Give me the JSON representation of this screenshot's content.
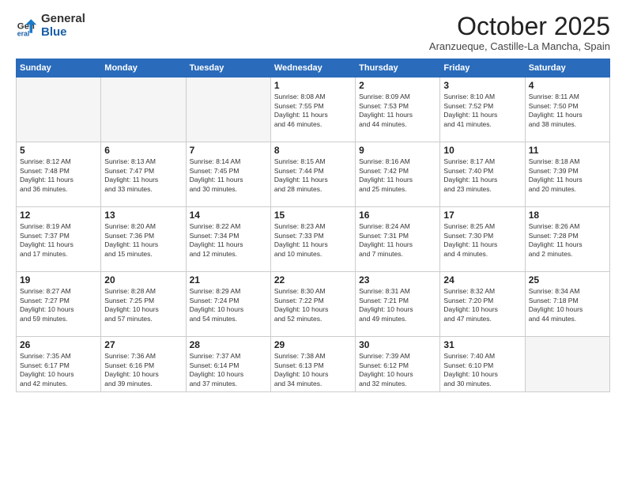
{
  "header": {
    "logo_general": "General",
    "logo_blue": "Blue",
    "month_year": "October 2025",
    "location": "Aranzueque, Castille-La Mancha, Spain"
  },
  "weekdays": [
    "Sunday",
    "Monday",
    "Tuesday",
    "Wednesday",
    "Thursday",
    "Friday",
    "Saturday"
  ],
  "weeks": [
    [
      {
        "num": "",
        "info": ""
      },
      {
        "num": "",
        "info": ""
      },
      {
        "num": "",
        "info": ""
      },
      {
        "num": "1",
        "info": "Sunrise: 8:08 AM\nSunset: 7:55 PM\nDaylight: 11 hours\nand 46 minutes."
      },
      {
        "num": "2",
        "info": "Sunrise: 8:09 AM\nSunset: 7:53 PM\nDaylight: 11 hours\nand 44 minutes."
      },
      {
        "num": "3",
        "info": "Sunrise: 8:10 AM\nSunset: 7:52 PM\nDaylight: 11 hours\nand 41 minutes."
      },
      {
        "num": "4",
        "info": "Sunrise: 8:11 AM\nSunset: 7:50 PM\nDaylight: 11 hours\nand 38 minutes."
      }
    ],
    [
      {
        "num": "5",
        "info": "Sunrise: 8:12 AM\nSunset: 7:48 PM\nDaylight: 11 hours\nand 36 minutes."
      },
      {
        "num": "6",
        "info": "Sunrise: 8:13 AM\nSunset: 7:47 PM\nDaylight: 11 hours\nand 33 minutes."
      },
      {
        "num": "7",
        "info": "Sunrise: 8:14 AM\nSunset: 7:45 PM\nDaylight: 11 hours\nand 30 minutes."
      },
      {
        "num": "8",
        "info": "Sunrise: 8:15 AM\nSunset: 7:44 PM\nDaylight: 11 hours\nand 28 minutes."
      },
      {
        "num": "9",
        "info": "Sunrise: 8:16 AM\nSunset: 7:42 PM\nDaylight: 11 hours\nand 25 minutes."
      },
      {
        "num": "10",
        "info": "Sunrise: 8:17 AM\nSunset: 7:40 PM\nDaylight: 11 hours\nand 23 minutes."
      },
      {
        "num": "11",
        "info": "Sunrise: 8:18 AM\nSunset: 7:39 PM\nDaylight: 11 hours\nand 20 minutes."
      }
    ],
    [
      {
        "num": "12",
        "info": "Sunrise: 8:19 AM\nSunset: 7:37 PM\nDaylight: 11 hours\nand 17 minutes."
      },
      {
        "num": "13",
        "info": "Sunrise: 8:20 AM\nSunset: 7:36 PM\nDaylight: 11 hours\nand 15 minutes."
      },
      {
        "num": "14",
        "info": "Sunrise: 8:22 AM\nSunset: 7:34 PM\nDaylight: 11 hours\nand 12 minutes."
      },
      {
        "num": "15",
        "info": "Sunrise: 8:23 AM\nSunset: 7:33 PM\nDaylight: 11 hours\nand 10 minutes."
      },
      {
        "num": "16",
        "info": "Sunrise: 8:24 AM\nSunset: 7:31 PM\nDaylight: 11 hours\nand 7 minutes."
      },
      {
        "num": "17",
        "info": "Sunrise: 8:25 AM\nSunset: 7:30 PM\nDaylight: 11 hours\nand 4 minutes."
      },
      {
        "num": "18",
        "info": "Sunrise: 8:26 AM\nSunset: 7:28 PM\nDaylight: 11 hours\nand 2 minutes."
      }
    ],
    [
      {
        "num": "19",
        "info": "Sunrise: 8:27 AM\nSunset: 7:27 PM\nDaylight: 10 hours\nand 59 minutes."
      },
      {
        "num": "20",
        "info": "Sunrise: 8:28 AM\nSunset: 7:25 PM\nDaylight: 10 hours\nand 57 minutes."
      },
      {
        "num": "21",
        "info": "Sunrise: 8:29 AM\nSunset: 7:24 PM\nDaylight: 10 hours\nand 54 minutes."
      },
      {
        "num": "22",
        "info": "Sunrise: 8:30 AM\nSunset: 7:22 PM\nDaylight: 10 hours\nand 52 minutes."
      },
      {
        "num": "23",
        "info": "Sunrise: 8:31 AM\nSunset: 7:21 PM\nDaylight: 10 hours\nand 49 minutes."
      },
      {
        "num": "24",
        "info": "Sunrise: 8:32 AM\nSunset: 7:20 PM\nDaylight: 10 hours\nand 47 minutes."
      },
      {
        "num": "25",
        "info": "Sunrise: 8:34 AM\nSunset: 7:18 PM\nDaylight: 10 hours\nand 44 minutes."
      }
    ],
    [
      {
        "num": "26",
        "info": "Sunrise: 7:35 AM\nSunset: 6:17 PM\nDaylight: 10 hours\nand 42 minutes."
      },
      {
        "num": "27",
        "info": "Sunrise: 7:36 AM\nSunset: 6:16 PM\nDaylight: 10 hours\nand 39 minutes."
      },
      {
        "num": "28",
        "info": "Sunrise: 7:37 AM\nSunset: 6:14 PM\nDaylight: 10 hours\nand 37 minutes."
      },
      {
        "num": "29",
        "info": "Sunrise: 7:38 AM\nSunset: 6:13 PM\nDaylight: 10 hours\nand 34 minutes."
      },
      {
        "num": "30",
        "info": "Sunrise: 7:39 AM\nSunset: 6:12 PM\nDaylight: 10 hours\nand 32 minutes."
      },
      {
        "num": "31",
        "info": "Sunrise: 7:40 AM\nSunset: 6:10 PM\nDaylight: 10 hours\nand 30 minutes."
      },
      {
        "num": "",
        "info": ""
      }
    ]
  ]
}
